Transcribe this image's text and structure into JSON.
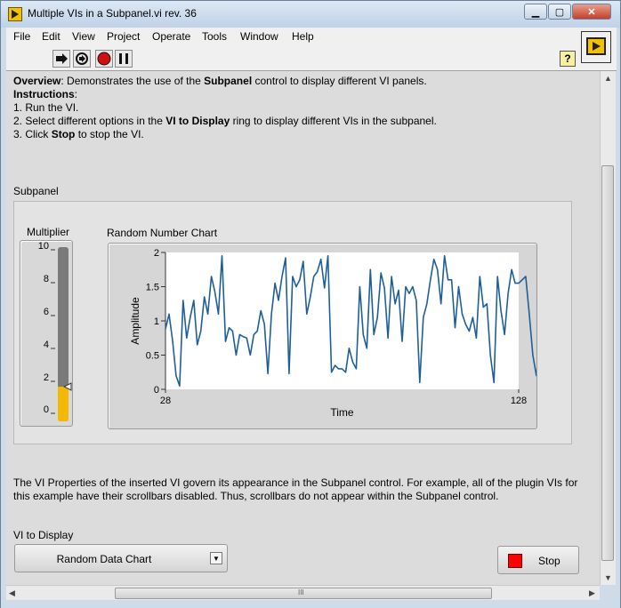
{
  "window": {
    "title": "Multiple VIs in a Subpanel.vi rev. 36",
    "minimize_glyph": "▁",
    "maximize_glyph": "▢",
    "close_glyph": "✕"
  },
  "menu": [
    "File",
    "Edit",
    "View",
    "Project",
    "Operate",
    "Tools",
    "Window",
    "Help"
  ],
  "toolbar": {
    "help_glyph": "?",
    "icons": [
      "run-arrow-icon",
      "run-continuously-icon",
      "abort-icon",
      "pause-icon"
    ]
  },
  "overview": {
    "label": "Overview",
    "text_before": ": Demonstrates the use of the ",
    "bold": "Subpanel",
    "text_after": " control to display different VI panels."
  },
  "instructions": {
    "heading": "Instructions",
    "colon": ":",
    "step1": "1. Run the VI.",
    "step2_before": "2. Select different options in the ",
    "step2_bold": "VI to Display",
    "step2_after": " ring to display different VIs in the subpanel.",
    "step3_before": "3. Click ",
    "step3_bold": "Stop",
    "step3_after": " to stop the VI."
  },
  "subpanel_label": "Subpanel",
  "multiplier": {
    "label": "Multiplier",
    "ticks": [
      "10",
      "8",
      "6",
      "4",
      "2",
      "0"
    ],
    "value": 2,
    "max": 10,
    "fill_color": "#f5b800"
  },
  "chart_label": "Random Number Chart",
  "chart_data": {
    "type": "line",
    "xlabel": "Time",
    "ylabel": "Amplitude",
    "xlim": [
      28,
      128
    ],
    "ylim": [
      0,
      2
    ],
    "xticks": [
      "28",
      "128"
    ],
    "yticks": [
      "0",
      "0.5",
      "1",
      "1.5",
      "2"
    ],
    "color": "#1f5f99",
    "x_start": 28,
    "x_step": 1,
    "values": [
      0.88,
      1.1,
      0.72,
      0.2,
      0.05,
      1.3,
      0.75,
      1.05,
      1.3,
      0.65,
      0.85,
      1.35,
      1.1,
      1.65,
      1.42,
      1.1,
      1.95,
      0.7,
      0.9,
      0.85,
      0.5,
      0.8,
      0.77,
      0.75,
      0.5,
      0.8,
      0.85,
      1.15,
      0.95,
      0.23,
      1.1,
      1.55,
      1.3,
      1.65,
      1.92,
      0.23,
      1.65,
      1.5,
      1.6,
      1.87,
      1.1,
      1.35,
      1.65,
      1.72,
      1.9,
      1.48,
      1.95,
      0.25,
      0.35,
      0.3,
      0.3,
      0.25,
      0.6,
      0.4,
      0.3,
      1.5,
      0.8,
      0.6,
      1.75,
      0.8,
      1.05,
      1.7,
      1.48,
      0.75,
      1.65,
      1.25,
      1.45,
      0.7,
      1.5,
      1.4,
      1.5,
      1.3,
      0.1,
      1.05,
      1.25,
      1.6,
      1.9,
      1.75,
      1.25,
      1.95,
      1.6,
      1.6,
      0.9,
      1.5,
      1.1,
      0.95,
      0.85,
      1.05,
      0.75,
      1.65,
      1.2,
      1.25,
      0.5,
      0.1,
      1.65,
      1.15,
      0.8,
      1.4,
      1.75,
      1.55,
      1.55,
      1.6,
      1.65,
      1.1,
      0.5,
      0.2,
      0.7
    ]
  },
  "properties_note": {
    "line1": "The VI Properties of the inserted VI govern its appearance in the Subpanel control. For example, all of the plugin VIs for",
    "line2": "this example have their scrollbars disabled. Thus, scrollbars do not appear within the Subpanel control."
  },
  "vi_to_display": {
    "label": "VI to Display",
    "selected": "Random Data Chart",
    "arrow_glyph": "▼"
  },
  "stop_button": {
    "label": "Stop"
  },
  "scrollbars": {
    "up": "▲",
    "down": "▼",
    "left": "◀",
    "right": "▶",
    "grip": "III"
  }
}
